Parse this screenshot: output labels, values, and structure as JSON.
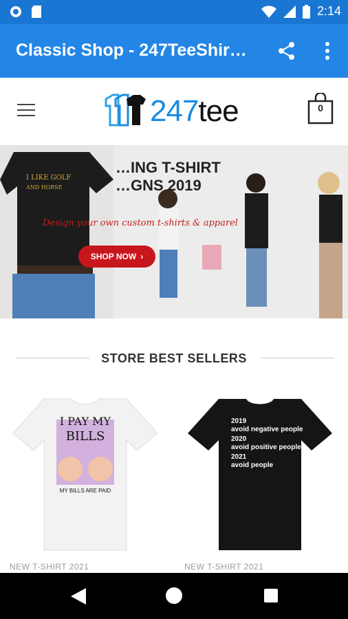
{
  "status_bar": {
    "time": "2:14",
    "icons": [
      "circle-status-icon",
      "sd-card-icon",
      "wifi-icon",
      "signal-icon",
      "battery-icon"
    ]
  },
  "app_bar": {
    "title": "Classic Shop - 247TeeShir…",
    "color": "#2386e6",
    "icons": [
      "share-icon",
      "more-vert-icon"
    ]
  },
  "header": {
    "logo": {
      "number": "247",
      "word": "tee"
    },
    "cart_count": "0"
  },
  "banner": {
    "title_line1": "…ING T-SHIRT",
    "title_line2": "…GNS 2019",
    "tagline": "Design your own custom t-shirts & apparel",
    "tee_text": "I LIKE GOLF AND HORSE",
    "shop_button": "SHOP NOW",
    "button_color": "#c8161d"
  },
  "section": {
    "title": "STORE BEST SELLERS"
  },
  "products": [
    {
      "category": "NEW T-SHIRT 2021",
      "shirt_color": "#f2f2f2",
      "print_line1": "I PAY MY",
      "print_line2": "BILLS",
      "print_line3": "MY BILLS ARE PAID"
    },
    {
      "category": "NEW T-SHIRT 2021",
      "shirt_color": "#151515",
      "print_line1": "2019",
      "print_line2": "avoid negative people",
      "print_line3": "2020",
      "print_line4": "avoid positive people",
      "print_line5": "2021",
      "print_line6": "avoid people"
    }
  ]
}
